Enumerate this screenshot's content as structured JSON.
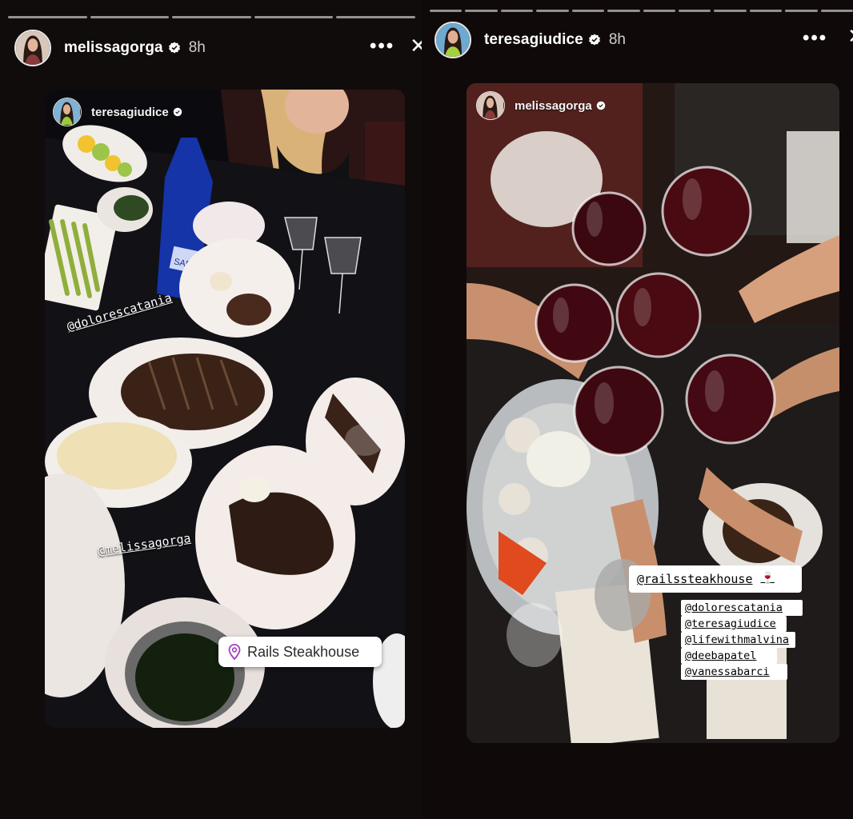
{
  "left_story": {
    "username": "melissagorga",
    "time_ago": "8h",
    "progress_segments": 5,
    "more_label": "•••",
    "close_label": "✕",
    "shared_post": {
      "username": "teresagiudice",
      "mentions": [
        "@dolorescatania",
        "@melissagorga"
      ],
      "location": "Rails Steakhouse",
      "bottle_label": "SARATOGA"
    }
  },
  "right_story": {
    "username": "teresagiudice",
    "time_ago": "8h",
    "progress_segments": 12,
    "more_label": "•••",
    "close_label": "✕",
    "shared_post": {
      "username": "melissagorga",
      "main_tag": "@railssteakhouse",
      "main_tag_emoji": "🍷",
      "tags": [
        "@dolorescatania",
        "@teresagiudice",
        "@lifewithmalvina",
        "@deebapatel",
        "@vanessabarci"
      ]
    }
  },
  "colors": {
    "background": "#0e0b0b",
    "tablecloth": "#0c0c10",
    "wine": "#4a0a12",
    "verified_blue": "#ffffff"
  }
}
